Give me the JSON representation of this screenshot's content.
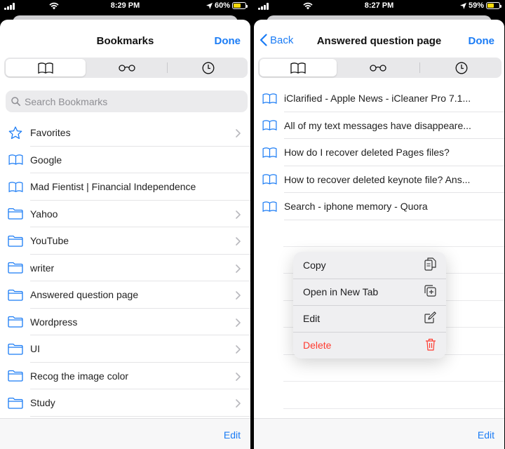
{
  "colors": {
    "accent": "#1b7cf5",
    "destructive": "#ff3b30",
    "battery": "#f5d90a"
  },
  "left": {
    "status": {
      "time": "8:29 PM",
      "battery": "60%",
      "battery_level": 0.6
    },
    "nav": {
      "title": "Bookmarks",
      "done": "Done"
    },
    "search": {
      "placeholder": "Search Bookmarks"
    },
    "items": [
      {
        "label": "Favorites",
        "icon": "star-icon",
        "chevron": true
      },
      {
        "label": "Google",
        "icon": "book-icon",
        "chevron": false
      },
      {
        "label": "Mad Fientist | Financial Independence",
        "icon": "book-icon",
        "chevron": false
      },
      {
        "label": "Yahoo",
        "icon": "folder-icon",
        "chevron": true
      },
      {
        "label": "YouTube",
        "icon": "folder-icon",
        "chevron": true
      },
      {
        "label": "writer",
        "icon": "folder-icon",
        "chevron": true
      },
      {
        "label": "Answered question page",
        "icon": "folder-icon",
        "chevron": true
      },
      {
        "label": "Wordpress",
        "icon": "folder-icon",
        "chevron": true
      },
      {
        "label": "UI",
        "icon": "folder-icon",
        "chevron": true
      },
      {
        "label": "Recog the image color",
        "icon": "folder-icon",
        "chevron": true
      },
      {
        "label": "Study",
        "icon": "folder-icon",
        "chevron": true
      }
    ],
    "toolbar": {
      "edit": "Edit"
    }
  },
  "right": {
    "status": {
      "time": "8:27 PM",
      "battery": "59%",
      "battery_level": 0.59
    },
    "nav": {
      "back": "Back",
      "title": "Answered question page",
      "done": "Done"
    },
    "items": [
      {
        "label": "iClarified - Apple News - iCleaner Pro 7.1...",
        "icon": "book-icon"
      },
      {
        "label": "All of my text messages have disappeare...",
        "icon": "book-icon"
      },
      {
        "label": "How do I recover deleted Pages files?",
        "icon": "book-icon"
      },
      {
        "label": "How to recover deleted keynote file? Ans...",
        "icon": "book-icon"
      },
      {
        "label": "Search - iphone memory - Quora",
        "icon": "book-icon"
      }
    ],
    "context_menu": [
      {
        "label": "Copy",
        "icon": "copy-icon"
      },
      {
        "label": "Open in New Tab",
        "icon": "new-tab-icon"
      },
      {
        "label": "Edit",
        "icon": "edit-icon"
      },
      {
        "label": "Delete",
        "icon": "trash-icon"
      }
    ],
    "toolbar": {
      "edit": "Edit"
    }
  }
}
